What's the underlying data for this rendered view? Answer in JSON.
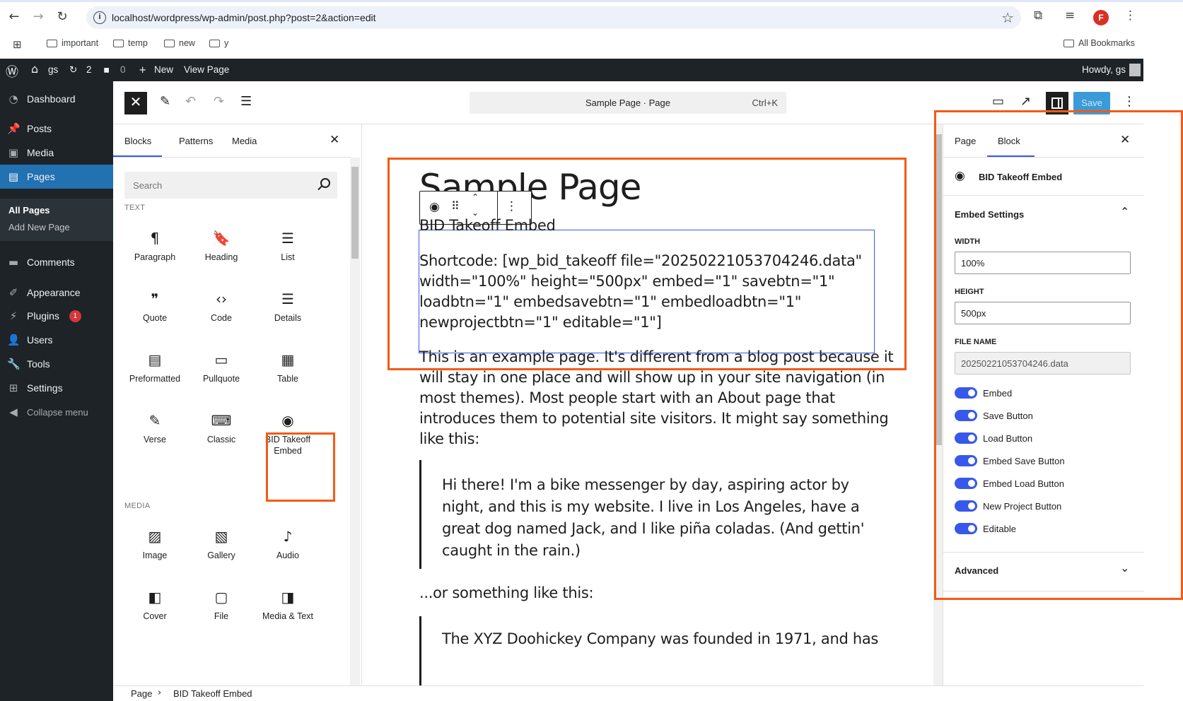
{
  "browser": {
    "url": "localhost/wordpress/wp-admin/post.php?post=2&action=edit",
    "profile_initial": "F",
    "bookmarks": [
      "important",
      "temp",
      "new",
      "y"
    ],
    "all_bookmarks": "All Bookmarks"
  },
  "admin_bar": {
    "site_name": "gs",
    "updates_count": "2",
    "comments_count": "0",
    "new_label": "New",
    "view_page": "View Page",
    "howdy": "Howdy, gs"
  },
  "sidebar": {
    "items": [
      {
        "label": "Dashboard",
        "icon": "dashboard-icon"
      },
      {
        "label": "Posts",
        "icon": "pin-icon"
      },
      {
        "label": "Media",
        "icon": "media-icon"
      },
      {
        "label": "Pages",
        "icon": "pages-icon"
      },
      {
        "label": "Comments",
        "icon": "comment-icon"
      },
      {
        "label": "Appearance",
        "icon": "brush-icon"
      },
      {
        "label": "Plugins",
        "icon": "plugin-icon",
        "badge": "1"
      },
      {
        "label": "Users",
        "icon": "user-icon"
      },
      {
        "label": "Tools",
        "icon": "wrench-icon"
      },
      {
        "label": "Settings",
        "icon": "settings-icon"
      },
      {
        "label": "Collapse menu",
        "icon": "collapse-icon"
      }
    ],
    "submenu": [
      "All Pages",
      "Add New Page"
    ]
  },
  "editor_toolbar": {
    "doc_title": "Sample Page · Page",
    "shortcut": "Ctrl+K",
    "save_label": "Save"
  },
  "inserter": {
    "tabs": [
      "Blocks",
      "Patterns",
      "Media"
    ],
    "search_placeholder": "Search",
    "categories": {
      "text": "TEXT",
      "media": "MEDIA"
    },
    "text_blocks": [
      {
        "label": "Paragraph",
        "icon": "¶"
      },
      {
        "label": "Heading",
        "icon": "🔖"
      },
      {
        "label": "List",
        "icon": "☰"
      },
      {
        "label": "Quote",
        "icon": "❞"
      },
      {
        "label": "Code",
        "icon": "‹›"
      },
      {
        "label": "Details",
        "icon": "☰"
      },
      {
        "label": "Preformatted",
        "icon": "▤"
      },
      {
        "label": "Pullquote",
        "icon": "▭"
      },
      {
        "label": "Table",
        "icon": "▦"
      },
      {
        "label": "Verse",
        "icon": "✎"
      },
      {
        "label": "Classic",
        "icon": "⌨"
      },
      {
        "label": "BID Takeoff Embed",
        "icon": "◉"
      }
    ],
    "media_blocks": [
      {
        "label": "Image",
        "icon": "▨"
      },
      {
        "label": "Gallery",
        "icon": "▧"
      },
      {
        "label": "Audio",
        "icon": "♪"
      },
      {
        "label": "Cover",
        "icon": "◧"
      },
      {
        "label": "File",
        "icon": "▢"
      },
      {
        "label": "Media & Text",
        "icon": "◨"
      }
    ]
  },
  "canvas": {
    "title": "Sample Page",
    "embed_title": "BID Takeoff Embed",
    "embed_shortcode": [
      "Shortcode: [wp_bid_takeoff file=\"20250221053704246.data\"",
      "width=\"100%\" height=\"500px\" embed=\"1\" savebtn=\"1\"",
      "loadbtn=\"1\" embedsavebtn=\"1\" embedloadbtn=\"1\"",
      "newprojectbtn=\"1\" editable=\"1\"]"
    ],
    "paragraph1": [
      "This is an example page. It's different from a blog post because it",
      "will stay in one place and will show up in your site navigation (in",
      "most themes). Most people start with an About page that",
      "introduces them to potential site visitors. It might say something",
      "like this:"
    ],
    "quote1": [
      "Hi there! I'm a bike messenger by day, aspiring actor by",
      "night, and this is my website. I live in Los Angeles, have a",
      "great dog named Jack, and I like piña coladas. (And gettin'",
      "caught in the rain.)"
    ],
    "paragraph2": "...or something like this:",
    "quote2": "The XYZ Doohickey Company was founded in 1971, and has"
  },
  "settings_panel": {
    "tabs": [
      "Page",
      "Block"
    ],
    "block_name": "BID Takeoff Embed",
    "section_title": "Embed Settings",
    "width_label": "WIDTH",
    "width_value": "100%",
    "height_label": "HEIGHT",
    "height_value": "500px",
    "file_label": "FILE NAME",
    "file_value": "20250221053704246.data",
    "toggles": [
      "Embed",
      "Save Button",
      "Load Button",
      "Embed Save Button",
      "Embed Load Button",
      "New Project Button",
      "Editable"
    ],
    "advanced": "Advanced"
  },
  "breadcrumb": {
    "root": "Page",
    "current": "BID Takeoff Embed"
  },
  "colors": {
    "accent": "#3858e9",
    "admin_dark": "#1d2327",
    "highlight": "#f55a14",
    "active_menu": "#2271b1"
  }
}
